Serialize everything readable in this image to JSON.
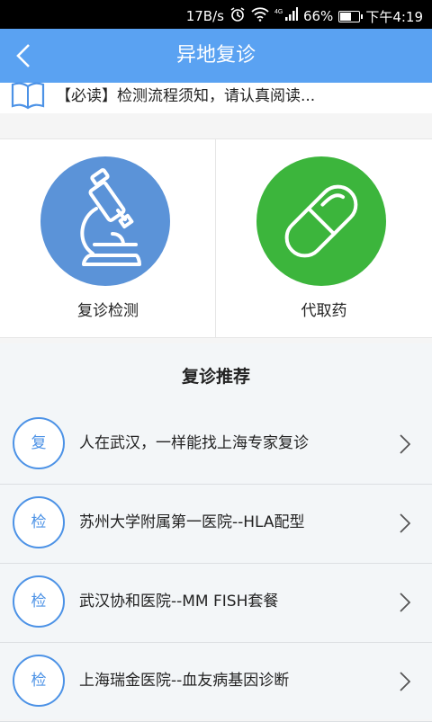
{
  "status_bar": {
    "speed": "17B/s",
    "battery_percent": "66%",
    "battery_level": 0.66,
    "time": "下午4:19",
    "net_badge": "4G",
    "icons": [
      "alarm-icon",
      "wifi-icon",
      "signal-icon",
      "battery-icon"
    ]
  },
  "header": {
    "title": "异地复诊",
    "back_icon": "chevron-left-icon"
  },
  "notice": {
    "text": "【必读】检测流程须知，请认真阅读...",
    "icon": "book-icon"
  },
  "services": [
    {
      "label": "复诊检测",
      "icon": "microscope-icon",
      "color": "#5b93d8"
    },
    {
      "label": "代取药",
      "icon": "pill-icon",
      "color": "#3cb53c"
    }
  ],
  "recommend": {
    "heading": "复诊推荐",
    "items": [
      {
        "badge": "复",
        "text": "人在武汉，一样能找上海专家复诊"
      },
      {
        "badge": "检",
        "text": "苏州大学附属第一医院--HLA配型"
      },
      {
        "badge": "检",
        "text": "武汉协和医院--MM FISH套餐"
      },
      {
        "badge": "检",
        "text": "上海瑞金医院--血友病基因诊断"
      }
    ]
  },
  "colors": {
    "primary": "#5aa2f2",
    "badge_blue": "#4c92e6"
  }
}
